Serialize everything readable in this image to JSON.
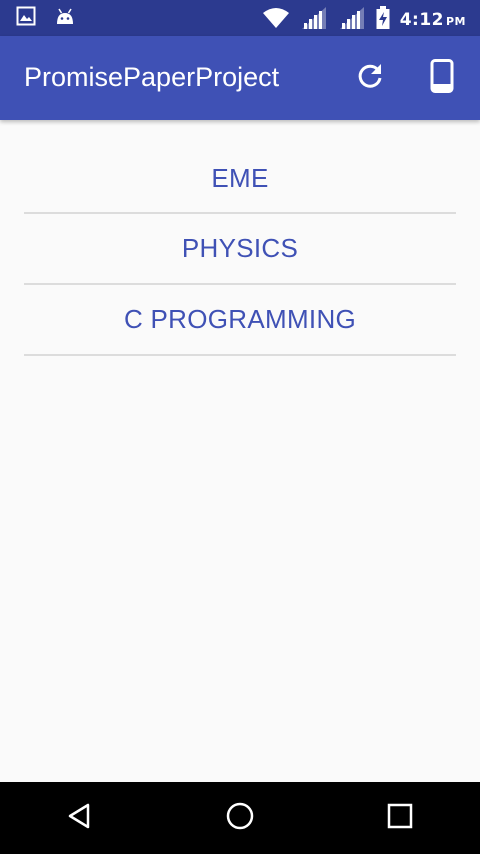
{
  "status_bar": {
    "time": "4:12",
    "ampm": "PM",
    "icons": [
      "image-icon",
      "android-icon",
      "wifi-icon",
      "signal-icon",
      "signal-icon",
      "battery-charging-icon"
    ]
  },
  "app_bar": {
    "title": "PromisePaperProject",
    "actions": [
      "refresh-icon",
      "phone-icon"
    ]
  },
  "subjects": [
    {
      "label": "EME"
    },
    {
      "label": "PHYSICS"
    },
    {
      "label": "C PROGRAMMING"
    }
  ],
  "colors": {
    "primary": "#3f51b5",
    "primary_dark": "#2c3a8f",
    "background": "#fafafa",
    "divider": "#dcdcdc"
  },
  "nav_bar": {
    "buttons": [
      "back-icon",
      "home-icon",
      "recents-icon"
    ]
  }
}
